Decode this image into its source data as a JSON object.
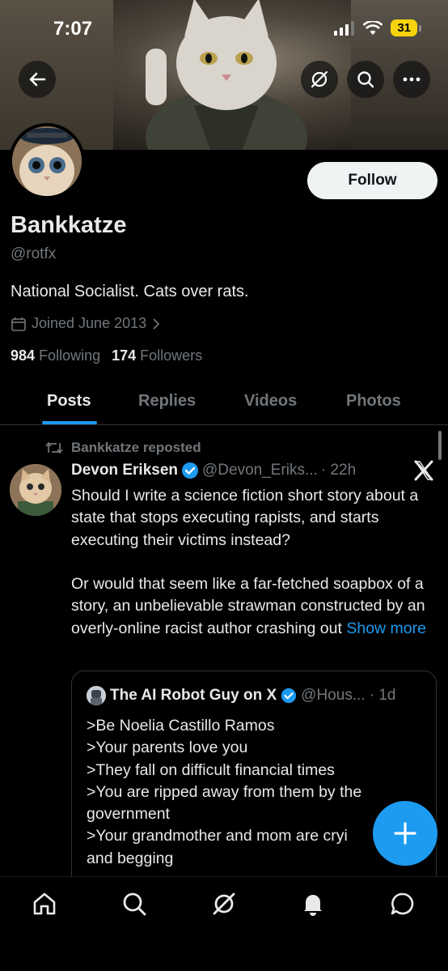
{
  "status_bar": {
    "time": "7:07",
    "battery": "31"
  },
  "profile": {
    "name": "Bankkatze",
    "handle": "@rotfx",
    "bio": "National Socialist. Cats over rats.",
    "joined": "Joined June 2013",
    "following_count": "984",
    "following_label": "Following",
    "followers_count": "174",
    "followers_label": "Followers",
    "follow_button": "Follow"
  },
  "tabs": [
    {
      "label": "Posts",
      "active": true
    },
    {
      "label": "Replies"
    },
    {
      "label": "Videos"
    },
    {
      "label": "Photos"
    }
  ],
  "post": {
    "repost_label": "Bankkatze reposted",
    "author_name": "Devon Eriksen",
    "author_handle": "@Devon_Eriks...",
    "time": "· 22h",
    "text": "Should I write a science fiction short story about a state that stops executing rapists, and starts executing their victims instead?\n\nOr would that seem like a far-fetched soapbox of a story, an unbelievable strawman constructed by an overly-online racist author crashing out ",
    "show_more": "Show more",
    "quote": {
      "author_name": "The AI Robot Guy on X",
      "author_handle": "@Hous...",
      "time": "· 1d",
      "lines": [
        ">Be Noelia Castillo Ramos",
        ">Your parents love you",
        ">They fall on difficult financial times",
        ">You are ripped away from them by the government",
        ">Your grandmother and mom are cryi",
        "and begging"
      ]
    }
  },
  "colors": {
    "accent": "#1d9bf0",
    "muted": "#71767b",
    "text": "#e7e9ea"
  }
}
